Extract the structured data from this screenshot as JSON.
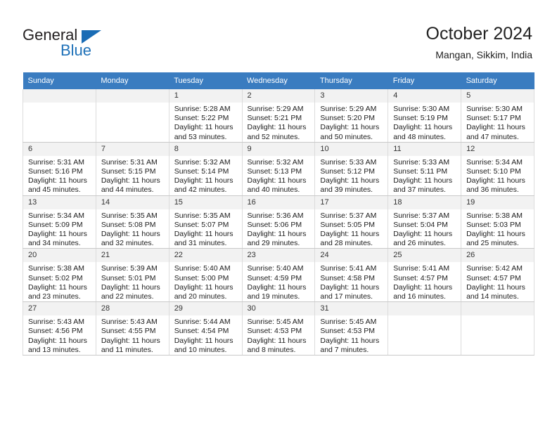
{
  "brand": {
    "name_top": "General",
    "name_bottom": "Blue",
    "accent_color": "#1a6cb5"
  },
  "header": {
    "title": "October 2024",
    "subtitle": "Mangan, Sikkim, India"
  },
  "calendar": {
    "header_bg": "#3a7cc0",
    "weekday_headers": [
      "Sunday",
      "Monday",
      "Tuesday",
      "Wednesday",
      "Thursday",
      "Friday",
      "Saturday"
    ],
    "labels": {
      "sunrise": "Sunrise:",
      "sunset": "Sunset:",
      "daylight": "Daylight:"
    },
    "weeks": [
      [
        {
          "day": "",
          "sunrise": "",
          "sunset": "",
          "daylight": ""
        },
        {
          "day": "",
          "sunrise": "",
          "sunset": "",
          "daylight": ""
        },
        {
          "day": "1",
          "sunrise": "Sunrise: 5:28 AM",
          "sunset": "Sunset: 5:22 PM",
          "daylight": "Daylight: 11 hours and 53 minutes."
        },
        {
          "day": "2",
          "sunrise": "Sunrise: 5:29 AM",
          "sunset": "Sunset: 5:21 PM",
          "daylight": "Daylight: 11 hours and 52 minutes."
        },
        {
          "day": "3",
          "sunrise": "Sunrise: 5:29 AM",
          "sunset": "Sunset: 5:20 PM",
          "daylight": "Daylight: 11 hours and 50 minutes."
        },
        {
          "day": "4",
          "sunrise": "Sunrise: 5:30 AM",
          "sunset": "Sunset: 5:19 PM",
          "daylight": "Daylight: 11 hours and 48 minutes."
        },
        {
          "day": "5",
          "sunrise": "Sunrise: 5:30 AM",
          "sunset": "Sunset: 5:17 PM",
          "daylight": "Daylight: 11 hours and 47 minutes."
        }
      ],
      [
        {
          "day": "6",
          "sunrise": "Sunrise: 5:31 AM",
          "sunset": "Sunset: 5:16 PM",
          "daylight": "Daylight: 11 hours and 45 minutes."
        },
        {
          "day": "7",
          "sunrise": "Sunrise: 5:31 AM",
          "sunset": "Sunset: 5:15 PM",
          "daylight": "Daylight: 11 hours and 44 minutes."
        },
        {
          "day": "8",
          "sunrise": "Sunrise: 5:32 AM",
          "sunset": "Sunset: 5:14 PM",
          "daylight": "Daylight: 11 hours and 42 minutes."
        },
        {
          "day": "9",
          "sunrise": "Sunrise: 5:32 AM",
          "sunset": "Sunset: 5:13 PM",
          "daylight": "Daylight: 11 hours and 40 minutes."
        },
        {
          "day": "10",
          "sunrise": "Sunrise: 5:33 AM",
          "sunset": "Sunset: 5:12 PM",
          "daylight": "Daylight: 11 hours and 39 minutes."
        },
        {
          "day": "11",
          "sunrise": "Sunrise: 5:33 AM",
          "sunset": "Sunset: 5:11 PM",
          "daylight": "Daylight: 11 hours and 37 minutes."
        },
        {
          "day": "12",
          "sunrise": "Sunrise: 5:34 AM",
          "sunset": "Sunset: 5:10 PM",
          "daylight": "Daylight: 11 hours and 36 minutes."
        }
      ],
      [
        {
          "day": "13",
          "sunrise": "Sunrise: 5:34 AM",
          "sunset": "Sunset: 5:09 PM",
          "daylight": "Daylight: 11 hours and 34 minutes."
        },
        {
          "day": "14",
          "sunrise": "Sunrise: 5:35 AM",
          "sunset": "Sunset: 5:08 PM",
          "daylight": "Daylight: 11 hours and 32 minutes."
        },
        {
          "day": "15",
          "sunrise": "Sunrise: 5:35 AM",
          "sunset": "Sunset: 5:07 PM",
          "daylight": "Daylight: 11 hours and 31 minutes."
        },
        {
          "day": "16",
          "sunrise": "Sunrise: 5:36 AM",
          "sunset": "Sunset: 5:06 PM",
          "daylight": "Daylight: 11 hours and 29 minutes."
        },
        {
          "day": "17",
          "sunrise": "Sunrise: 5:37 AM",
          "sunset": "Sunset: 5:05 PM",
          "daylight": "Daylight: 11 hours and 28 minutes."
        },
        {
          "day": "18",
          "sunrise": "Sunrise: 5:37 AM",
          "sunset": "Sunset: 5:04 PM",
          "daylight": "Daylight: 11 hours and 26 minutes."
        },
        {
          "day": "19",
          "sunrise": "Sunrise: 5:38 AM",
          "sunset": "Sunset: 5:03 PM",
          "daylight": "Daylight: 11 hours and 25 minutes."
        }
      ],
      [
        {
          "day": "20",
          "sunrise": "Sunrise: 5:38 AM",
          "sunset": "Sunset: 5:02 PM",
          "daylight": "Daylight: 11 hours and 23 minutes."
        },
        {
          "day": "21",
          "sunrise": "Sunrise: 5:39 AM",
          "sunset": "Sunset: 5:01 PM",
          "daylight": "Daylight: 11 hours and 22 minutes."
        },
        {
          "day": "22",
          "sunrise": "Sunrise: 5:40 AM",
          "sunset": "Sunset: 5:00 PM",
          "daylight": "Daylight: 11 hours and 20 minutes."
        },
        {
          "day": "23",
          "sunrise": "Sunrise: 5:40 AM",
          "sunset": "Sunset: 4:59 PM",
          "daylight": "Daylight: 11 hours and 19 minutes."
        },
        {
          "day": "24",
          "sunrise": "Sunrise: 5:41 AM",
          "sunset": "Sunset: 4:58 PM",
          "daylight": "Daylight: 11 hours and 17 minutes."
        },
        {
          "day": "25",
          "sunrise": "Sunrise: 5:41 AM",
          "sunset": "Sunset: 4:57 PM",
          "daylight": "Daylight: 11 hours and 16 minutes."
        },
        {
          "day": "26",
          "sunrise": "Sunrise: 5:42 AM",
          "sunset": "Sunset: 4:57 PM",
          "daylight": "Daylight: 11 hours and 14 minutes."
        }
      ],
      [
        {
          "day": "27",
          "sunrise": "Sunrise: 5:43 AM",
          "sunset": "Sunset: 4:56 PM",
          "daylight": "Daylight: 11 hours and 13 minutes."
        },
        {
          "day": "28",
          "sunrise": "Sunrise: 5:43 AM",
          "sunset": "Sunset: 4:55 PM",
          "daylight": "Daylight: 11 hours and 11 minutes."
        },
        {
          "day": "29",
          "sunrise": "Sunrise: 5:44 AM",
          "sunset": "Sunset: 4:54 PM",
          "daylight": "Daylight: 11 hours and 10 minutes."
        },
        {
          "day": "30",
          "sunrise": "Sunrise: 5:45 AM",
          "sunset": "Sunset: 4:53 PM",
          "daylight": "Daylight: 11 hours and 8 minutes."
        },
        {
          "day": "31",
          "sunrise": "Sunrise: 5:45 AM",
          "sunset": "Sunset: 4:53 PM",
          "daylight": "Daylight: 11 hours and 7 minutes."
        },
        {
          "day": "",
          "sunrise": "",
          "sunset": "",
          "daylight": ""
        },
        {
          "day": "",
          "sunrise": "",
          "sunset": "",
          "daylight": ""
        }
      ]
    ]
  }
}
